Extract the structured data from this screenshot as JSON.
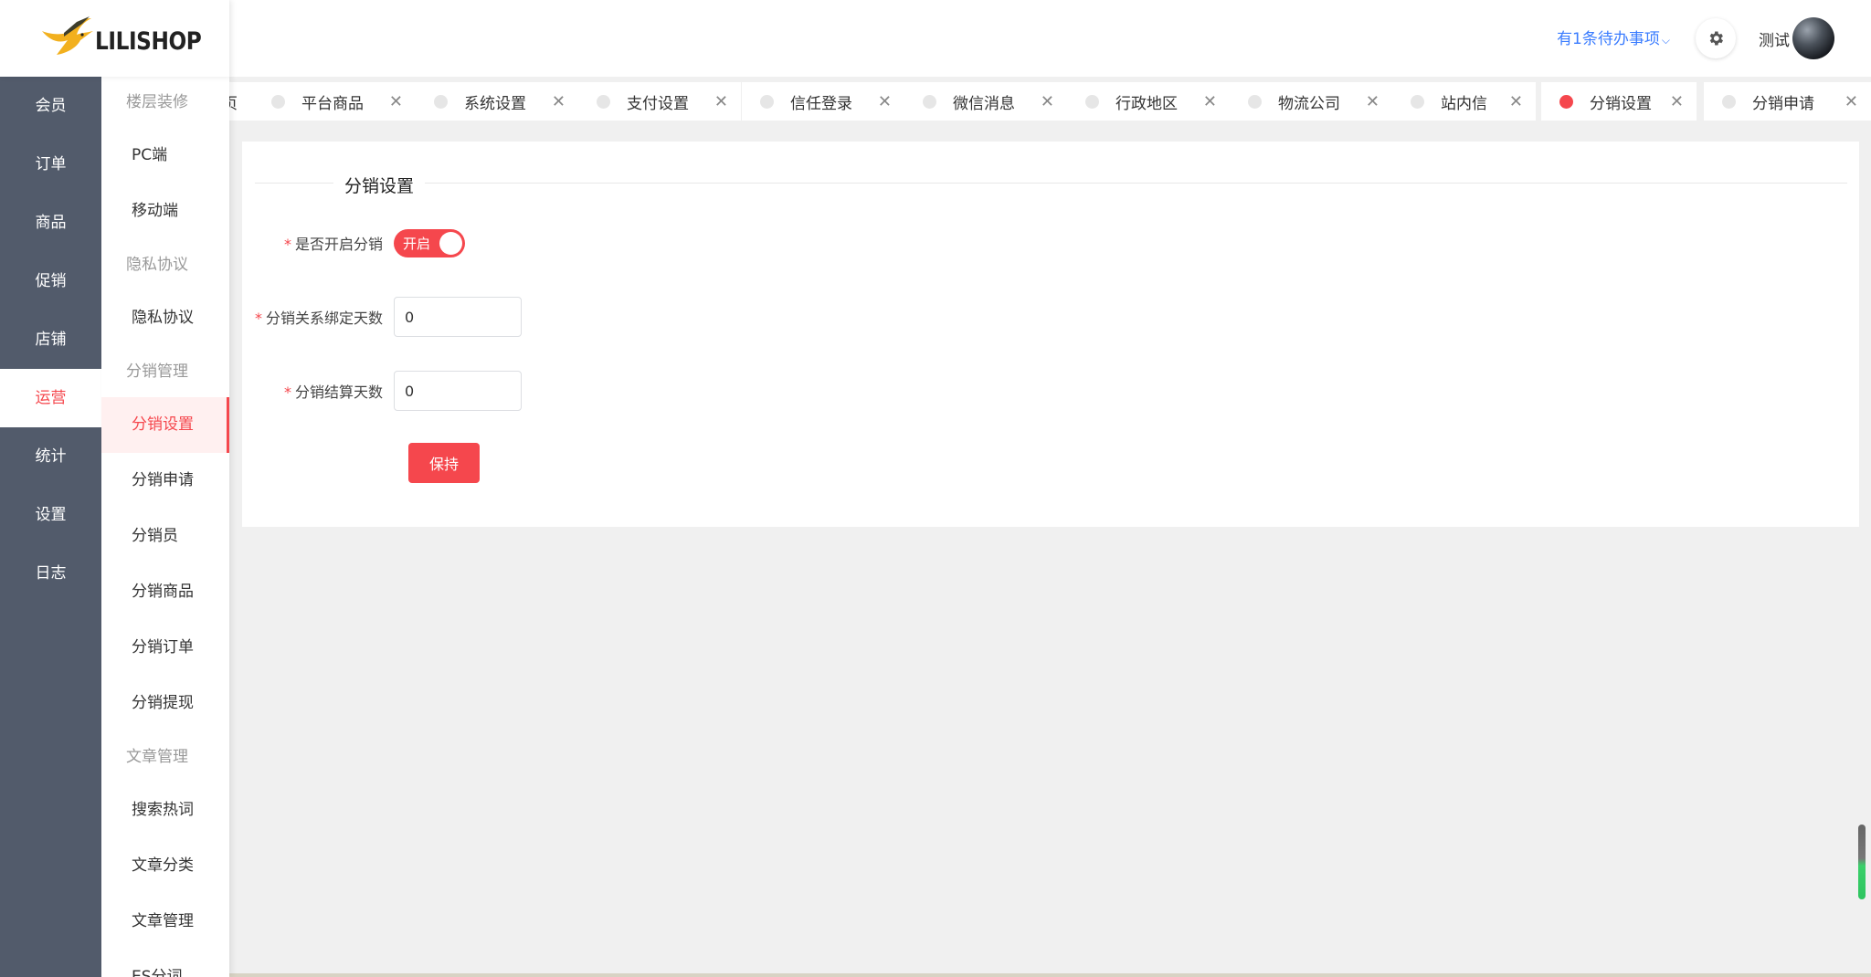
{
  "brand": {
    "name": "LILISHOP"
  },
  "header": {
    "todo_text": "有1条待办事项",
    "username": "测试"
  },
  "sidebar": {
    "items": [
      {
        "label": "会员"
      },
      {
        "label": "订单"
      },
      {
        "label": "商品"
      },
      {
        "label": "促销"
      },
      {
        "label": "店铺"
      },
      {
        "label": "运营",
        "active": true
      },
      {
        "label": "统计"
      },
      {
        "label": "设置"
      },
      {
        "label": "日志"
      }
    ]
  },
  "submenu": {
    "entries": [
      {
        "type": "group",
        "label": "楼层装修"
      },
      {
        "type": "item",
        "label": "PC端"
      },
      {
        "type": "item",
        "label": "移动端"
      },
      {
        "type": "group",
        "label": "隐私协议"
      },
      {
        "type": "item",
        "label": "隐私协议"
      },
      {
        "type": "group",
        "label": "分销管理"
      },
      {
        "type": "item",
        "label": "分销设置",
        "active": true
      },
      {
        "type": "item",
        "label": "分销申请"
      },
      {
        "type": "item",
        "label": "分销员"
      },
      {
        "type": "item",
        "label": "分销商品"
      },
      {
        "type": "item",
        "label": "分销订单"
      },
      {
        "type": "item",
        "label": "分销提现"
      },
      {
        "type": "group",
        "label": "文章管理"
      },
      {
        "type": "item",
        "label": "搜索热词"
      },
      {
        "type": "item",
        "label": "文章分类"
      },
      {
        "type": "item",
        "label": "文章管理"
      },
      {
        "type": "item",
        "label": "ES分词"
      }
    ]
  },
  "tabs": [
    {
      "label": "页"
    },
    {
      "label": "平台商品"
    },
    {
      "label": "系统设置"
    },
    {
      "label": "支付设置"
    },
    {
      "label": "信任登录"
    },
    {
      "label": "微信消息"
    },
    {
      "label": "行政地区"
    },
    {
      "label": "物流公司"
    },
    {
      "label": "站内信"
    },
    {
      "label": "分销设置",
      "active": true
    },
    {
      "label": "分销申请"
    }
  ],
  "form": {
    "section_title": "分销设置",
    "enable": {
      "label": "是否开启分销",
      "switch_text": "开启",
      "checked": true
    },
    "bind_days": {
      "label": "分销关系绑定天数",
      "value": "0"
    },
    "settle_days": {
      "label": "分销结算天数",
      "value": "0"
    },
    "save_label": "保持"
  },
  "colors": {
    "accent": "#f5474d",
    "sidebar_bg": "#525b6b",
    "link": "#3a7cff"
  }
}
